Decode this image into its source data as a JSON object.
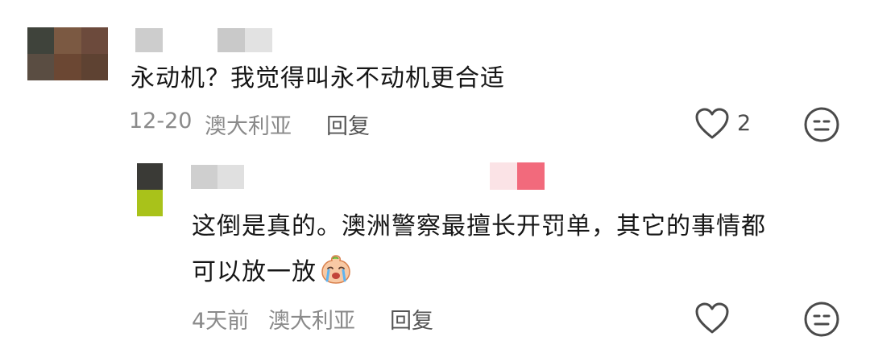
{
  "comments": [
    {
      "content": "永动机？我觉得叫永不动机更合适",
      "date": "12-20",
      "location": "澳大利亚",
      "reply_label": "回复",
      "like_count": "2",
      "avatar_colors": [
        "#3f433b",
        "#7b5942",
        "#6c4a3c",
        "#5a4d42",
        "#6b4733",
        "#5e4232"
      ]
    }
  ],
  "replies": [
    {
      "content_line1": "这倒是真的。澳洲警察最擅长开罚单，其它的事情都",
      "content_line2": "可以放一放",
      "emoji": "crying-face-emoji",
      "date": "4天前",
      "location": "澳大利亚",
      "reply_label": "回复",
      "avatar_colors": [
        "#3a3a36",
        "#a9c21a"
      ]
    }
  ],
  "colors": {
    "text": "#161616",
    "meta": "#8a8a8a",
    "icon": "#4a4a4a"
  }
}
